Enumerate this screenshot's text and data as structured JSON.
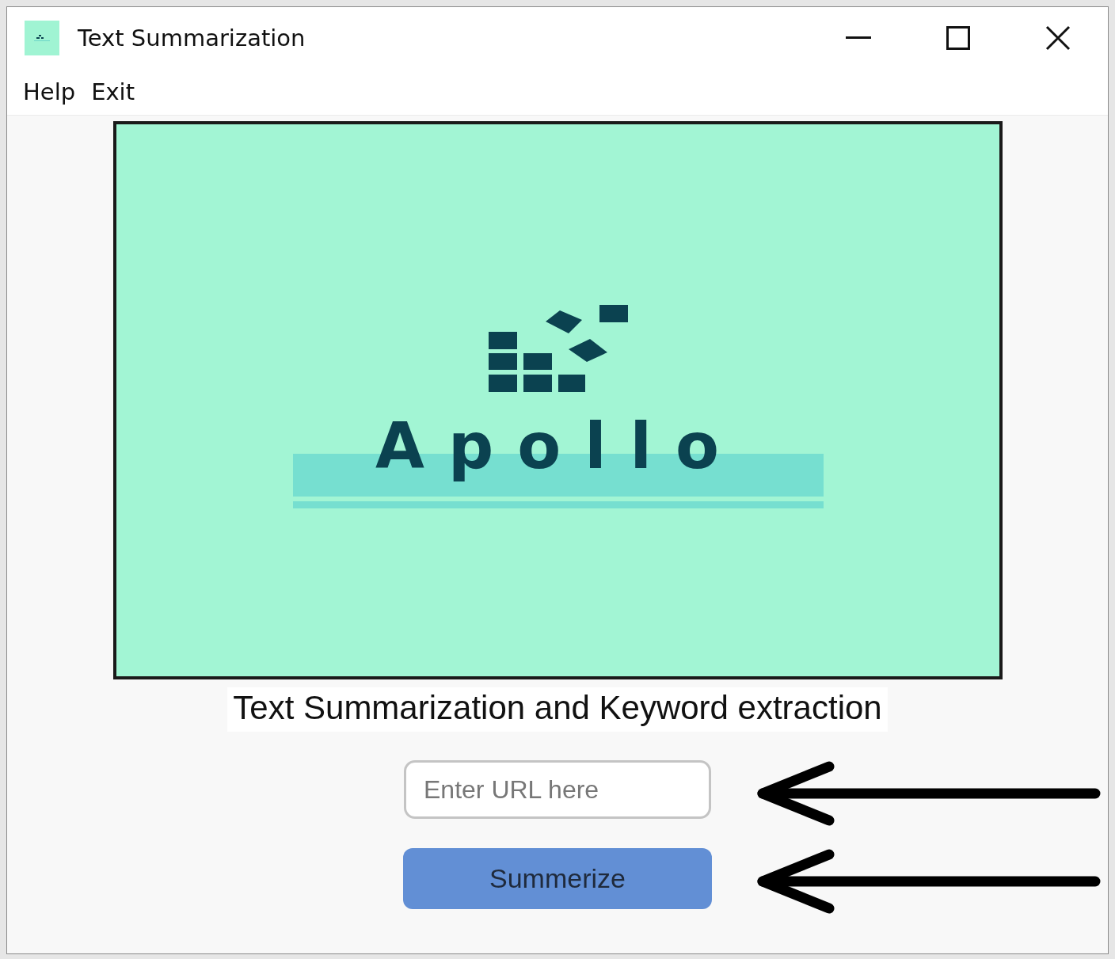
{
  "window": {
    "title": "Text Summarization"
  },
  "menu": [
    {
      "label": "Help"
    },
    {
      "label": "Exit"
    }
  ],
  "banner": {
    "logo_text": "Apollo"
  },
  "caption": "Text Summarization and Keyword extraction",
  "url_field": {
    "placeholder": "Enter URL here",
    "marked": true
  },
  "submit_button": {
    "label": "Summerize",
    "marked": true
  }
}
